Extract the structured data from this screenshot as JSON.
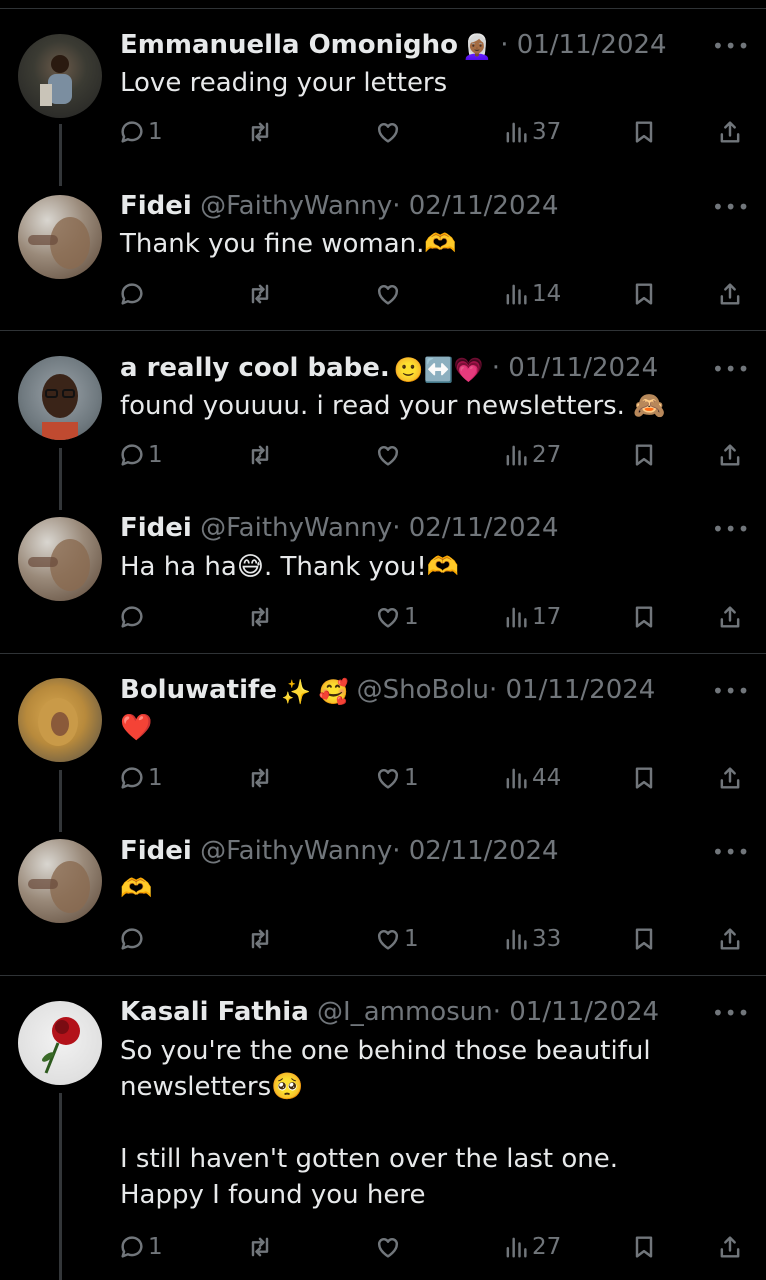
{
  "replies": [
    {
      "name": "Emmanuella Omonigho",
      "name_emoji": "👩🏾‍🦳",
      "handle": "",
      "date": "· 01/11/2024",
      "text": "Love reading your letters",
      "stats": {
        "replies": "1",
        "retweets": "",
        "likes": "",
        "views": "37"
      }
    },
    {
      "name": "Fidei",
      "name_emoji": "",
      "handle": "@FaithyWanny",
      "date": "· 02/11/2024",
      "text": "Thank you fine woman.🫶",
      "stats": {
        "replies": "",
        "retweets": "",
        "likes": "",
        "views": "14"
      }
    },
    {
      "name": "a really cool babe.",
      "name_emoji": "🙂↔️💗",
      "handle": "",
      "date": "· 01/11/2024",
      "text": "found youuuu. i read your newsletters. 🙈",
      "stats": {
        "replies": "1",
        "retweets": "",
        "likes": "",
        "views": "27"
      }
    },
    {
      "name": "Fidei",
      "name_emoji": "",
      "handle": "@FaithyWanny",
      "date": "· 02/11/2024",
      "text": "Ha ha ha😅. Thank you!🫶",
      "stats": {
        "replies": "",
        "retweets": "",
        "likes": "1",
        "views": "17"
      }
    },
    {
      "name": "Boluwatife",
      "name_emoji": "✨ 🥰",
      "handle": "@ShoBolu",
      "date": "· 01/11/2024",
      "text": "❤️",
      "stats": {
        "replies": "1",
        "retweets": "",
        "likes": "1",
        "views": "44"
      }
    },
    {
      "name": "Fidei",
      "name_emoji": "",
      "handle": "@FaithyWanny",
      "date": "· 02/11/2024",
      "text": "🫶",
      "stats": {
        "replies": "",
        "retweets": "",
        "likes": "1",
        "views": "33"
      }
    },
    {
      "name": "Kasali Fathia",
      "name_emoji": "",
      "handle": "@I_ammosun",
      "date": "· 01/11/2024",
      "text": "So you're the one behind those beautiful newsletters🥺\n\nI still haven't gotten over the last one. Happy I found you here",
      "stats": {
        "replies": "1",
        "retweets": "",
        "likes": "",
        "views": "27"
      }
    }
  ],
  "more_label": "•••",
  "colors": {
    "background": "#000000",
    "text": "#e7e9ea",
    "muted": "#71767b",
    "divider": "#2f3336"
  }
}
